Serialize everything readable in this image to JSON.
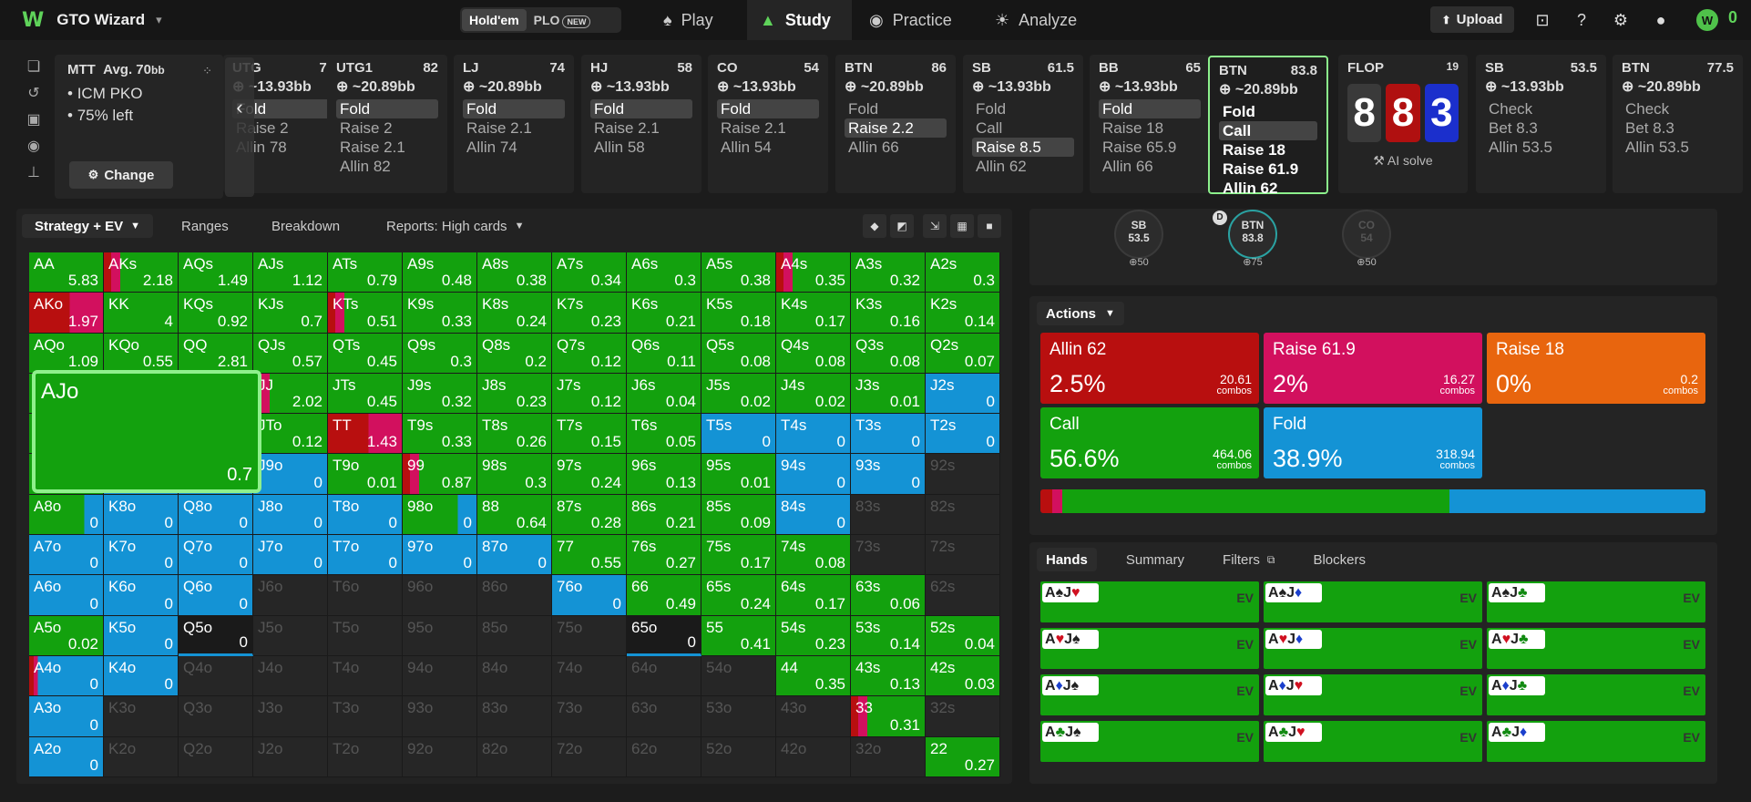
{
  "app": {
    "name": "GTO Wizard",
    "logo": "W"
  },
  "game_toggle": {
    "holdem": "Hold'em",
    "plo": "PLO",
    "new": "NEW"
  },
  "nav": [
    {
      "label": "Play",
      "icon": "spade-icon"
    },
    {
      "label": "Study",
      "icon": "graduation-cap-icon"
    },
    {
      "label": "Practice",
      "icon": "gamepad-icon"
    },
    {
      "label": "Analyze",
      "icon": "bulb-icon"
    }
  ],
  "topbar": {
    "upload": "Upload",
    "balance": "0"
  },
  "mtt": {
    "title": "MTT",
    "avg": "Avg. 70",
    "avg_unit": "bb",
    "line1": "ICM PKO",
    "line2": "75% left",
    "change": "Change"
  },
  "positions": [
    {
      "name": "UTG",
      "stack": "78",
      "pot": "~13.93bb",
      "actions": [
        "Fold",
        "Raise 2",
        "Allin 78"
      ],
      "sel": 0
    },
    {
      "name": "UTG1",
      "stack": "82",
      "pot": "~20.89bb",
      "actions": [
        "Fold",
        "Raise 2",
        "Raise 2.1",
        "Allin 82"
      ],
      "sel": 0
    },
    {
      "name": "LJ",
      "stack": "74",
      "pot": "~20.89bb",
      "actions": [
        "Fold",
        "Raise 2.1",
        "Allin 74"
      ],
      "sel": 0
    },
    {
      "name": "HJ",
      "stack": "58",
      "pot": "~13.93bb",
      "actions": [
        "Fold",
        "Raise 2.1",
        "Allin 58"
      ],
      "sel": 0
    },
    {
      "name": "CO",
      "stack": "54",
      "pot": "~13.93bb",
      "actions": [
        "Fold",
        "Raise 2.1",
        "Allin 54"
      ],
      "sel": 0
    },
    {
      "name": "BTN",
      "stack": "86",
      "pot": "~20.89bb",
      "actions": [
        "Fold",
        "Raise 2.2",
        "Allin 66"
      ],
      "sel": 1
    },
    {
      "name": "SB",
      "stack": "61.5",
      "pot": "~13.93bb",
      "actions": [
        "Fold",
        "Call",
        "Raise 8.5",
        "Allin 62"
      ],
      "sel": 2
    },
    {
      "name": "BB",
      "stack": "65",
      "pot": "~13.93bb",
      "actions": [
        "Fold",
        "Raise 18",
        "Raise 65.9",
        "Allin 66"
      ],
      "sel": 0
    },
    {
      "name": "BTN",
      "stack": "83.8",
      "pot": "~20.89bb",
      "actions": [
        "Fold",
        "Call",
        "Raise 18",
        "Raise 61.9",
        "Allin 62"
      ],
      "sel": 1,
      "current": true
    }
  ],
  "flop": {
    "label": "FLOP",
    "num": "19",
    "cards": [
      {
        "r": "8",
        "c": "#3a3a3a"
      },
      {
        "r": "8",
        "c": "#b01010"
      },
      {
        "r": "3",
        "c": "#1b2fcc"
      }
    ],
    "ai": "AI solve"
  },
  "later": [
    {
      "name": "SB",
      "stack": "53.5",
      "pot": "~13.93bb",
      "actions": [
        "Check",
        "Bet 8.3",
        "Allin 53.5"
      ]
    },
    {
      "name": "BTN",
      "stack": "77.5",
      "pot": "~20.89bb",
      "actions": [
        "Check",
        "Bet 8.3",
        "Allin 53.5"
      ]
    }
  ],
  "tabs": {
    "strategy": "Strategy + EV",
    "ranges": "Ranges",
    "breakdown": "Breakdown",
    "reports": "Reports: High cards"
  },
  "matrix": [
    [
      "AA|5.83|g",
      "AKs|2.18|m",
      "AQs|1.49|g",
      "AJs|1.12|g",
      "ATs|0.79|g",
      "A9s|0.48|g",
      "A8s|0.38|g",
      "A7s|0.34|g",
      "A6s|0.3|g",
      "A5s|0.38|g",
      "A4s|0.35|m",
      "A3s|0.32|g",
      "A2s|0.3|g"
    ],
    [
      "AKo|1.97|r",
      "KK|4|g",
      "KQs|0.92|g",
      "KJs|0.7|g",
      "KTs|0.51|m",
      "K9s|0.33|g",
      "K8s|0.24|g",
      "K7s|0.23|g",
      "K6s|0.21|g",
      "K5s|0.18|g",
      "K4s|0.17|g",
      "K3s|0.16|g",
      "K2s|0.14|g"
    ],
    [
      "AQo|1.09|g",
      "KQo|0.55|g",
      "QQ|2.81|g",
      "QJs|0.57|g",
      "QTs|0.45|g",
      "Q9s|0.3|g",
      "Q8s|0.2|g",
      "Q7s|0.12|g",
      "Q6s|0.11|g",
      "Q5s|0.08|g",
      "Q4s|0.08|g",
      "Q3s|0.08|g",
      "Q2s|0.07|g"
    ],
    [
      "AJo|0.7|g",
      "KJo|0.4|g",
      "QJo|0.3|g",
      "JJ|2.02|m",
      "JTs|0.45|g",
      "J9s|0.32|g",
      "J8s|0.23|g",
      "J7s|0.12|g",
      "J6s|0.04|g",
      "J5s|0.02|g",
      "J4s|0.02|g",
      "J3s|0.01|g",
      "J2s|0|b"
    ],
    [
      "ATo|0.3|g",
      "KTo|0.2|g",
      "QTo|0.12|g",
      "JTo|0.12|g",
      "TT|1.43|r",
      "T9s|0.33|g",
      "T8s|0.26|g",
      "T7s|0.15|g",
      "T6s|0.05|g",
      "T5s|0|b",
      "T4s|0|b",
      "T3s|0|b",
      "T2s|0|b"
    ],
    [
      "A9o|0.1|g",
      "K9o|0|b",
      "Q9o|0|b",
      "J9o|0|b",
      "T9o|0.01|g",
      "99|0.87|m",
      "98s|0.3|g",
      "97s|0.24|g",
      "96s|0.13|g",
      "95s|0.01|g",
      "94s|0|b",
      "93s|0|b",
      "92s||e"
    ],
    [
      "A8o|0|gb",
      "K8o|0|b",
      "Q8o|0|b",
      "J8o|0|b",
      "T8o|0|b",
      "98o|0|gb",
      "88|0.64|g",
      "87s|0.28|g",
      "86s|0.21|g",
      "85s|0.09|g",
      "84s|0|b",
      "83s||e",
      "82s||e"
    ],
    [
      "A7o|0|b",
      "K7o|0|b",
      "Q7o|0|b",
      "J7o|0|b",
      "T7o|0|b",
      "97o|0|b",
      "87o|0|b",
      "77|0.55|g",
      "76s|0.27|g",
      "75s|0.17|g",
      "74s|0.08|g",
      "73s||e",
      "72s||e"
    ],
    [
      "A6o|0|b",
      "K6o|0|b",
      "Q6o|0|b",
      "J6o||e",
      "T6o||e",
      "96o||e",
      "86o||e",
      "76o|0|b",
      "66|0.49|g",
      "65s|0.24|g",
      "64s|0.17|g",
      "63s|0.06|g",
      "62s||e"
    ],
    [
      "A5o|0.02|g",
      "K5o|0|b",
      "Q5o|0|d",
      "J5o||e",
      "T5o||e",
      "95o||e",
      "85o||e",
      "75o||e",
      "65o|0|d",
      "55|0.41|g",
      "54s|0.23|g",
      "53s|0.14|g",
      "52s|0.04|g"
    ],
    [
      "A4o|0|bm",
      "K4o|0|b",
      "Q4o||e",
      "J4o||e",
      "T4o||e",
      "94o||e",
      "84o||e",
      "74o||e",
      "64o||e",
      "54o||e",
      "44|0.35|g",
      "43s|0.13|g",
      "42s|0.03|g"
    ],
    [
      "A3o|0|b",
      "K3o||e",
      "Q3o||e",
      "J3o||e",
      "T3o||e",
      "93o||e",
      "83o||e",
      "73o||e",
      "63o||e",
      "53o||e",
      "43o||e",
      "33|0.31|m",
      "32s||e"
    ],
    [
      "A2o|0|b",
      "K2o||e",
      "Q2o||e",
      "J2o||e",
      "T2o||e",
      "92o||e",
      "82o||e",
      "72o||e",
      "62o||e",
      "52o||e",
      "42o||e",
      "32o||e",
      "22|0.27|g"
    ]
  ],
  "selected_cell": {
    "label": "AJo",
    "ev": "0.7"
  },
  "seats": [
    {
      "name": "SB",
      "stack": "53.5",
      "chips": "50"
    },
    {
      "name": "BTN",
      "stack": "83.8",
      "chips": "75"
    },
    {
      "name": "CO",
      "stack": "54",
      "chips": "50"
    }
  ],
  "dealer": "D",
  "actions_label": "Actions",
  "actions": [
    {
      "name": "Allin 62",
      "pct": "2.5%",
      "combos": "20.61",
      "color": "#b80f0f"
    },
    {
      "name": "Raise 61.9",
      "pct": "2%",
      "combos": "16.27",
      "color": "#d2105e"
    },
    {
      "name": "Raise 18",
      "pct": "0%",
      "combos": "0.2",
      "color": "#e8650e"
    },
    {
      "name": "Call",
      "pct": "56.6%",
      "combos": "464.06",
      "color": "#13a10e"
    },
    {
      "name": "Fold",
      "pct": "38.9%",
      "combos": "318.94",
      "color": "#1493d5"
    }
  ],
  "combos_word": "combos",
  "freqbar": [
    {
      "v": 1.8,
      "c": "#b80f0f"
    },
    {
      "v": 1.5,
      "c": "#d2105e"
    },
    {
      "v": 58.2,
      "c": "#13a10e"
    },
    {
      "v": 38.5,
      "c": "#1493d5"
    }
  ],
  "hands_tabs": {
    "hands": "Hands",
    "summary": "Summary",
    "filters": "Filters",
    "blockers": "Blockers"
  },
  "hands": [
    [
      "A",
      "♠",
      "s",
      "J",
      "♥",
      "r"
    ],
    [
      "A",
      "♠",
      "s",
      "J",
      "♦",
      "b"
    ],
    [
      "A",
      "♠",
      "s",
      "J",
      "♣",
      "g"
    ],
    [
      "A",
      "♥",
      "r",
      "J",
      "♠",
      "s"
    ],
    [
      "A",
      "♥",
      "r",
      "J",
      "♦",
      "b"
    ],
    [
      "A",
      "♥",
      "r",
      "J",
      "♣",
      "g"
    ],
    [
      "A",
      "♦",
      "b",
      "J",
      "♠",
      "s"
    ],
    [
      "A",
      "♦",
      "b",
      "J",
      "♥",
      "r"
    ],
    [
      "A",
      "♦",
      "b",
      "J",
      "♣",
      "g"
    ],
    [
      "A",
      "♣",
      "g",
      "J",
      "♠",
      "s"
    ],
    [
      "A",
      "♣",
      "g",
      "J",
      "♥",
      "r"
    ],
    [
      "A",
      "♣",
      "g",
      "J",
      "♦",
      "b"
    ]
  ],
  "hand_ev": "EV"
}
